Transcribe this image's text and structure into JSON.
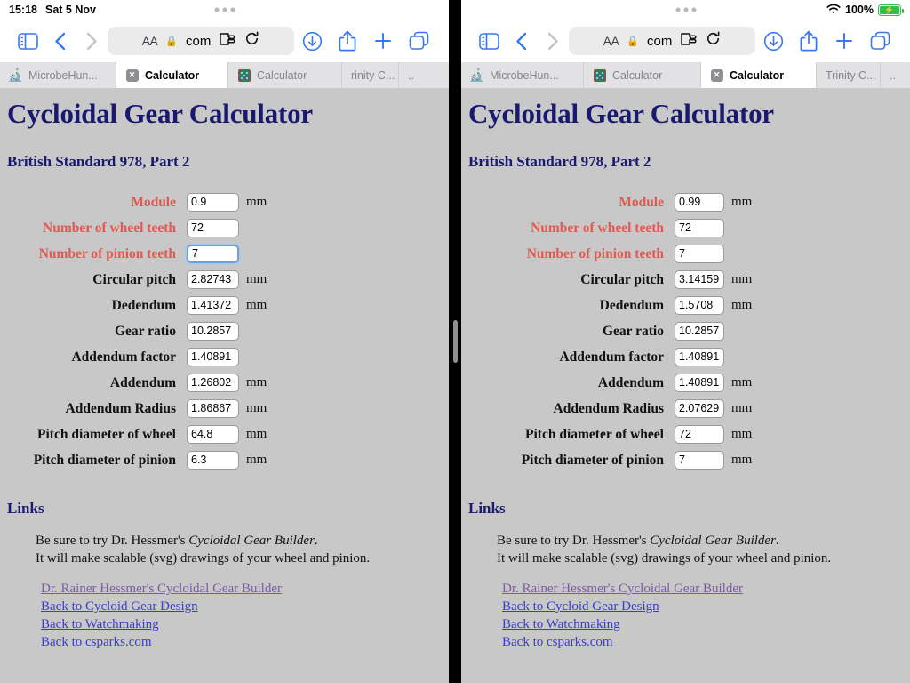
{
  "status": {
    "time": "15:18",
    "date": "Sat 5 Nov",
    "battery_percent": "100%",
    "wifi_icon": "wifi-icon",
    "battery_icon": "battery-charging-icon"
  },
  "toolbar": {
    "sidebar_icon": "sidebar-icon",
    "back_icon": "chevron-left-icon",
    "forward_icon": "chevron-right-icon",
    "aa_label": "AA",
    "lock_icon": "lock-icon",
    "url_text": "com",
    "extension_icon": "puzzle-extension-icon",
    "reload_icon": "reload-icon",
    "download_icon": "download-icon",
    "share_icon": "share-icon",
    "new_tab_icon": "plus-icon",
    "tabs_overview_icon": "tabs-overview-icon"
  },
  "left_pane": {
    "tabs": [
      {
        "label": "MicrobeHun...",
        "icon": "microscope-icon",
        "active": false
      },
      {
        "label": "Calculator",
        "icon": "close-x-icon",
        "active": true
      },
      {
        "label": "Calculator",
        "icon": "dice-favicon",
        "active": false
      },
      {
        "label": "rinity C...",
        "icon": "none",
        "active": false
      },
      {
        "label": "..",
        "icon": "none",
        "active": false
      }
    ],
    "page": {
      "title": "Cycloidal Gear Calculator",
      "subtitle": "British Standard 978, Part 2",
      "rows": [
        {
          "label": "Module",
          "value": "0.9",
          "unit": "mm",
          "editable": true,
          "focused": false
        },
        {
          "label": "Number of wheel teeth",
          "value": "72",
          "unit": "",
          "editable": true,
          "focused": false
        },
        {
          "label": "Number of pinion teeth",
          "value": "7",
          "unit": "",
          "editable": true,
          "focused": true
        },
        {
          "label": "Circular pitch",
          "value": "2.82743",
          "unit": "mm",
          "editable": false,
          "focused": false
        },
        {
          "label": "Dedendum",
          "value": "1.41372",
          "unit": "mm",
          "editable": false,
          "focused": false
        },
        {
          "label": "Gear ratio",
          "value": "10.2857",
          "unit": "",
          "editable": false,
          "focused": false
        },
        {
          "label": "Addendum factor",
          "value": "1.40891",
          "unit": "",
          "editable": false,
          "focused": false
        },
        {
          "label": "Addendum",
          "value": "1.26802",
          "unit": "mm",
          "editable": false,
          "focused": false
        },
        {
          "label": "Addendum Radius",
          "value": "1.86867",
          "unit": "mm",
          "editable": false,
          "focused": false
        },
        {
          "label": "Pitch diameter of wheel",
          "value": "64.8",
          "unit": "mm",
          "editable": false,
          "focused": false
        },
        {
          "label": "Pitch diameter of pinion",
          "value": "6.3",
          "unit": "mm",
          "editable": false,
          "focused": false
        }
      ],
      "links_heading": "Links",
      "para_line1_prefix": "Be sure to try Dr. Hessmer's ",
      "para_line1_em": "Cycloidal Gear Builder",
      "para_line1_suffix": ".",
      "para_line2": "It will make scalable (svg) drawings of your wheel and pinion.",
      "links": [
        {
          "text": "Dr. Rainer Hessmer's Cycloidal Gear Builder ",
          "visited": true
        },
        {
          "text": "Back to Cycloid Gear Design",
          "visited": false
        },
        {
          "text": "Back to Watchmaking",
          "visited": false
        },
        {
          "text": "Back to csparks.com",
          "visited": false
        }
      ]
    }
  },
  "right_pane": {
    "tabs": [
      {
        "label": "MicrobeHun...",
        "icon": "microscope-icon",
        "active": false
      },
      {
        "label": "Calculator",
        "icon": "dice-favicon",
        "active": false
      },
      {
        "label": "Calculator",
        "icon": "close-x-icon",
        "active": true
      },
      {
        "label": "Trinity C...",
        "icon": "none",
        "active": false
      },
      {
        "label": "..",
        "icon": "none",
        "active": false
      }
    ],
    "page": {
      "title": "Cycloidal Gear Calculator",
      "subtitle": "British Standard 978, Part 2",
      "rows": [
        {
          "label": "Module",
          "value": "0.99",
          "unit": "mm",
          "editable": true,
          "focused": false
        },
        {
          "label": "Number of wheel teeth",
          "value": "72",
          "unit": "",
          "editable": true,
          "focused": false
        },
        {
          "label": "Number of pinion teeth",
          "value": "7",
          "unit": "",
          "editable": true,
          "focused": false
        },
        {
          "label": "Circular pitch",
          "value": "3.14159",
          "unit": "mm",
          "editable": false,
          "focused": false
        },
        {
          "label": "Dedendum",
          "value": "1.5708",
          "unit": "mm",
          "editable": false,
          "focused": false
        },
        {
          "label": "Gear ratio",
          "value": "10.2857",
          "unit": "",
          "editable": false,
          "focused": false
        },
        {
          "label": "Addendum factor",
          "value": "1.40891",
          "unit": "",
          "editable": false,
          "focused": false
        },
        {
          "label": "Addendum",
          "value": "1.40891",
          "unit": "mm",
          "editable": false,
          "focused": false
        },
        {
          "label": "Addendum Radius",
          "value": "2.07629",
          "unit": "mm",
          "editable": false,
          "focused": false
        },
        {
          "label": "Pitch diameter of wheel",
          "value": "72",
          "unit": "mm",
          "editable": false,
          "focused": false
        },
        {
          "label": "Pitch diameter of pinion",
          "value": "7",
          "unit": "mm",
          "editable": false,
          "focused": false
        }
      ],
      "links_heading": "Links",
      "para_line1_prefix": "Be sure to try Dr. Hessmer's ",
      "para_line1_em": "Cycloidal Gear Builder",
      "para_line1_suffix": ".",
      "para_line2": "It will make scalable (svg) drawings of your wheel and pinion.",
      "links": [
        {
          "text": "Dr. Rainer Hessmer's Cycloidal Gear Builder ",
          "visited": true
        },
        {
          "text": "Back to Cycloid Gear Design",
          "visited": false
        },
        {
          "text": "Back to Watchmaking",
          "visited": false
        },
        {
          "text": "Back to csparks.com",
          "visited": false
        }
      ]
    }
  },
  "colors": {
    "page_bg": "#c8c8c8",
    "heading": "#191970",
    "input_label": "#e05a4f",
    "link": "#3b3bd0",
    "link_visited": "#7b5ba6",
    "accent": "#3478f6",
    "battery_green": "#2fbf4f"
  }
}
